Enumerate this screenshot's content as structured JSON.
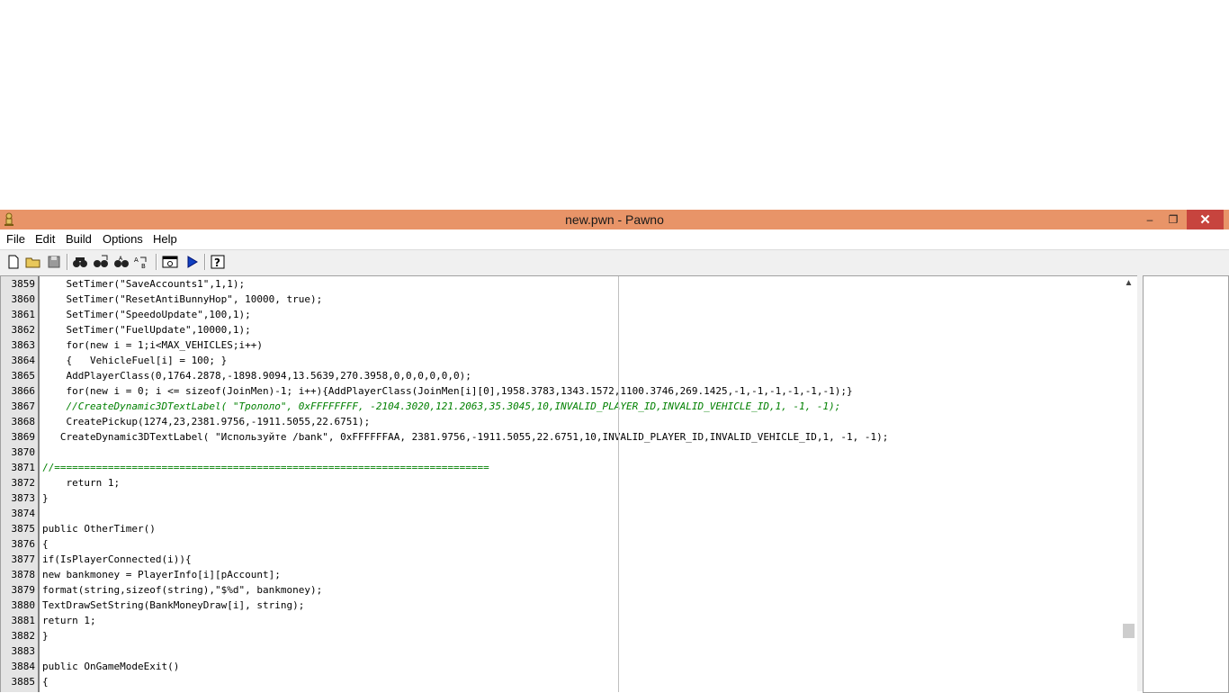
{
  "window": {
    "title": "new.pwn - Pawno",
    "titlebar_color": "#e89468",
    "close_color": "#c7443e",
    "controls": {
      "minimize": "–",
      "maximize": "❐",
      "close": "✕"
    }
  },
  "menu": [
    "File",
    "Edit",
    "Build",
    "Options",
    "Help"
  ],
  "toolbar": [
    "new-file-icon",
    "open-folder-icon",
    "save-disk-icon",
    "find-binoculars-icon",
    "find-next-icon",
    "replace-icon",
    "replace-all-icon",
    "compile-window-icon",
    "run-play-icon",
    "help-question-icon"
  ],
  "editor": {
    "line_numbers": [
      "3859",
      "3860",
      "3861",
      "3862",
      "3863",
      "3864",
      "3865",
      "3866",
      "3867",
      "3868",
      "3869",
      "3870",
      "3871",
      "3872",
      "3873",
      "3874",
      "3875",
      "3876",
      "3877",
      "3878",
      "3879",
      "3880",
      "3881",
      "3882",
      "3883",
      "3884",
      "3885"
    ],
    "lines": [
      "    SetTimer(\"SaveAccounts1\",1,1);",
      "    SetTimer(\"ResetAntiBunnyHop\", 10000, true);",
      "    SetTimer(\"SpeedoUpdate\",100,1);",
      "    SetTimer(\"FuelUpdate\",10000,1);",
      "    for(new i = 1;i<MAX_VEHICLES;i++)",
      "    {   VehicleFuel[i] = 100; }",
      "    AddPlayerClass(0,1764.2878,-1898.9094,13.5639,270.3958,0,0,0,0,0,0);",
      "    for(new i = 0; i <= sizeof(JoinMen)-1; i++){AddPlayerClass(JoinMen[i][0],1958.3783,1343.1572,1100.3746,269.1425,-1,-1,-1,-1,-1,-1);}",
      "    //CreateDynamic3DTextLabel( \"Трололо\", 0xFFFFFFFF, -2104.3020,121.2063,35.3045,10,INVALID_PLAYER_ID,INVALID_VEHICLE_ID,1, -1, -1);",
      "    CreatePickup(1274,23,2381.9756,-1911.5055,22.6751);",
      "   CreateDynamic3DTextLabel( \"Используйте /bank\", 0xFFFFFFAA, 2381.9756,-1911.5055,22.6751,10,INVALID_PLAYER_ID,INVALID_VEHICLE_ID,1, -1, -1);",
      "",
      "//=========================================================================",
      "    return 1;",
      "}",
      "",
      "public OtherTimer()",
      "{",
      "if(IsPlayerConnected(i)){",
      "new bankmoney = PlayerInfo[i][pAccount];",
      "format(string,sizeof(string),\"$%d\", bankmoney);",
      "TextDrawSetString(BankMoneyDraw[i], string);",
      "return 1;",
      "}",
      "",
      "public OnGameModeExit()",
      "{"
    ]
  }
}
